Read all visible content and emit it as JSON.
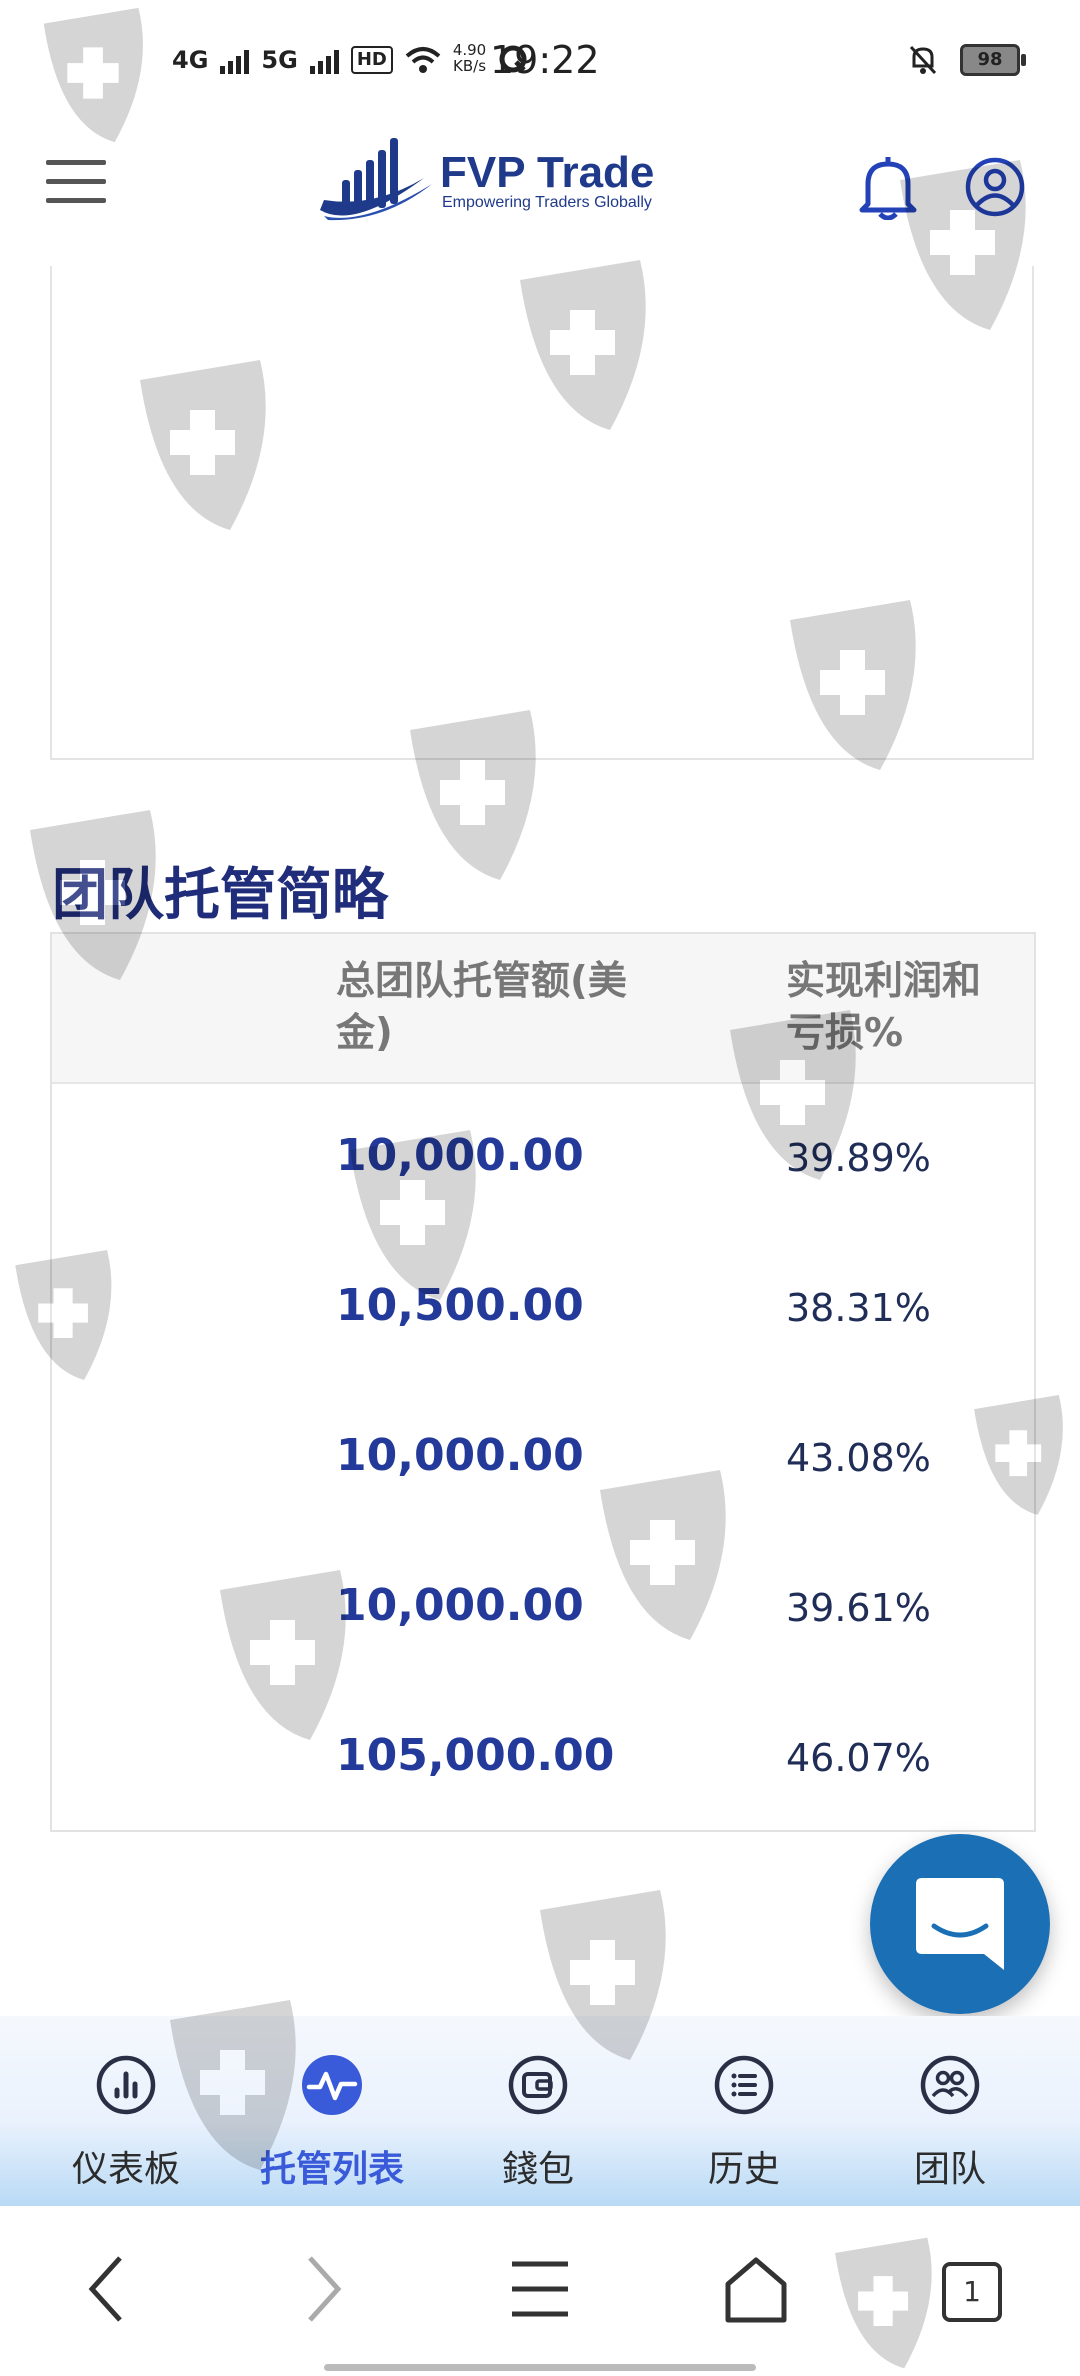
{
  "status_bar": {
    "net1": "4G",
    "net2": "5G",
    "hd": "HD",
    "speed_value": "4.90",
    "speed_unit": "KB/s",
    "time": "19:22",
    "battery": "98"
  },
  "header": {
    "logo_title": "FVP Trade",
    "logo_subtitle": "Empowering Traders Globally"
  },
  "summary": {
    "title": "团队托管简略",
    "col_total": "总团队托管额(美金)",
    "col_pnl": "实现利润和亏损%",
    "rows": [
      {
        "amount": "10,000.00",
        "pnl": "39.89%"
      },
      {
        "amount": "10,500.00",
        "pnl": "38.31%"
      },
      {
        "amount": "10,000.00",
        "pnl": "43.08%"
      },
      {
        "amount": "10,000.00",
        "pnl": "39.61%"
      },
      {
        "amount": "105,000.00",
        "pnl": "46.07%"
      }
    ]
  },
  "bottom_nav": {
    "items": [
      {
        "label": "仪表板",
        "icon": "dashboard-chart-icon"
      },
      {
        "label": "托管列表",
        "icon": "pulse-icon",
        "active": true
      },
      {
        "label": "錢包",
        "icon": "wallet-icon"
      },
      {
        "label": "历史",
        "icon": "history-list-icon"
      },
      {
        "label": "团队",
        "icon": "team-icon"
      }
    ]
  },
  "system_nav": {
    "tab_count": "1"
  },
  "colors": {
    "brand": "#1f3a8a",
    "amount": "#233a9a",
    "active_nav": "#3a5bd9",
    "chat_fab": "#1b6fb5"
  }
}
